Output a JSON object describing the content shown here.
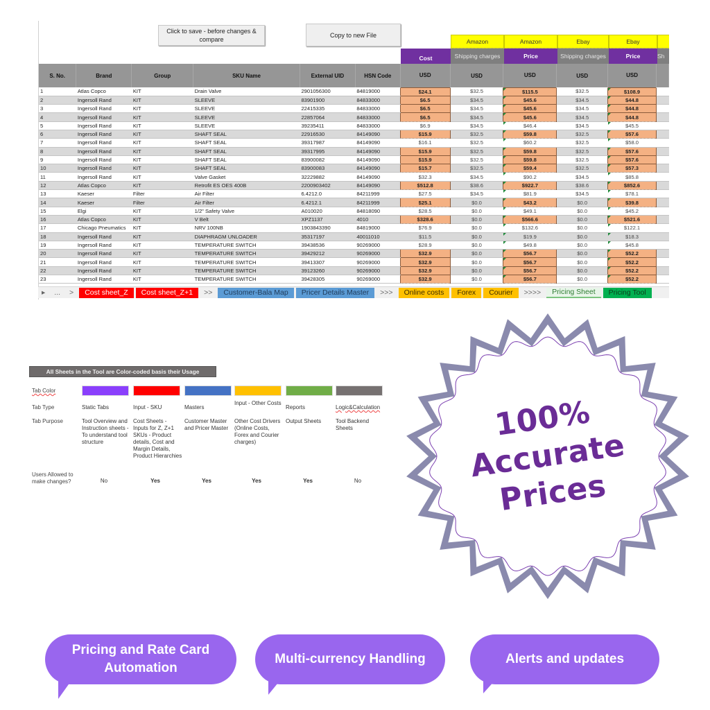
{
  "toolbar": {
    "save_label": "Click to save - before changes & compare",
    "copy_label": "Copy to new File"
  },
  "market_headers": [
    "Amazon",
    "Amazon",
    "Ebay",
    "Ebay"
  ],
  "sub_headers": [
    "Cost",
    "Shipping charges",
    "Price",
    "Shipping charges",
    "Price",
    "Sh"
  ],
  "columns": [
    "S. No.",
    "Brand",
    "Group",
    "SKU Name",
    "External UID",
    "HSN Code",
    "USD",
    "USD",
    "USD",
    "USD",
    "USD"
  ],
  "rows": [
    {
      "sno": "1",
      "brand": "Atlas Copco",
      "group": "KIT",
      "sku": "Drain Valve",
      "uid": "2901056300",
      "hsn": "84819000",
      "cost": "$24.1",
      "amz_ship": "$32.5",
      "amz_price": "$115.5",
      "ebay_ship": "$32.5",
      "ebay_price": "$108.9",
      "highlight": true
    },
    {
      "sno": "2",
      "brand": "Ingersoll Rand",
      "group": "KIT",
      "sku": "SLEEVE",
      "uid": "83901900",
      "hsn": "84833000",
      "cost": "$6.5",
      "amz_ship": "$34.5",
      "amz_price": "$45.6",
      "ebay_ship": "$34.5",
      "ebay_price": "$44.8",
      "highlight": true
    },
    {
      "sno": "3",
      "brand": "Ingersoll Rand",
      "group": "KIT",
      "sku": "SLEEVE",
      "uid": "22415335",
      "hsn": "84833000",
      "cost": "$6.5",
      "amz_ship": "$34.5",
      "amz_price": "$45.6",
      "ebay_ship": "$34.5",
      "ebay_price": "$44.8",
      "highlight": true
    },
    {
      "sno": "4",
      "brand": "Ingersoll Rand",
      "group": "KIT",
      "sku": "SLEEVE",
      "uid": "22857064",
      "hsn": "84833000",
      "cost": "$6.5",
      "amz_ship": "$34.5",
      "amz_price": "$45.6",
      "ebay_ship": "$34.5",
      "ebay_price": "$44.8",
      "highlight": true
    },
    {
      "sno": "5",
      "brand": "Ingersoll Rand",
      "group": "KIT",
      "sku": "SLEEVE",
      "uid": "39235411",
      "hsn": "84833000",
      "cost": "$6.9",
      "amz_ship": "$34.5",
      "amz_price": "$46.4",
      "ebay_ship": "$34.5",
      "ebay_price": "$45.5",
      "highlight": false
    },
    {
      "sno": "6",
      "brand": "Ingersoll Rand",
      "group": "KIT",
      "sku": "SHAFT SEAL",
      "uid": "22916530",
      "hsn": "84149090",
      "cost": "$15.9",
      "amz_ship": "$32.5",
      "amz_price": "$59.8",
      "ebay_ship": "$32.5",
      "ebay_price": "$57.6",
      "highlight": true
    },
    {
      "sno": "7",
      "brand": "Ingersoll Rand",
      "group": "KIT",
      "sku": "SHAFT SEAL",
      "uid": "39317987",
      "hsn": "84149090",
      "cost": "$16.1",
      "amz_ship": "$32.5",
      "amz_price": "$60.2",
      "ebay_ship": "$32.5",
      "ebay_price": "$58.0",
      "highlight": false
    },
    {
      "sno": "8",
      "brand": "Ingersoll Rand",
      "group": "KIT",
      "sku": "SHAFT SEAL",
      "uid": "39317995",
      "hsn": "84149090",
      "cost": "$15.9",
      "amz_ship": "$32.5",
      "amz_price": "$59.8",
      "ebay_ship": "$32.5",
      "ebay_price": "$57.6",
      "highlight": true
    },
    {
      "sno": "9",
      "brand": "Ingersoll Rand",
      "group": "KIT",
      "sku": "SHAFT SEAL",
      "uid": "83900082",
      "hsn": "84149090",
      "cost": "$15.9",
      "amz_ship": "$32.5",
      "amz_price": "$59.8",
      "ebay_ship": "$32.5",
      "ebay_price": "$57.6",
      "highlight": true
    },
    {
      "sno": "10",
      "brand": "Ingersoll Rand",
      "group": "KIT",
      "sku": "SHAFT SEAL",
      "uid": "83900083",
      "hsn": "84149090",
      "cost": "$15.7",
      "amz_ship": "$32.5",
      "amz_price": "$59.4",
      "ebay_ship": "$32.5",
      "ebay_price": "$57.3",
      "highlight": true
    },
    {
      "sno": "11",
      "brand": "Ingersoll Rand",
      "group": "KIT",
      "sku": "Valve Gasket",
      "uid": "32229882",
      "hsn": "84149090",
      "cost": "$32.3",
      "amz_ship": "$34.5",
      "amz_price": "$90.2",
      "ebay_ship": "$34.5",
      "ebay_price": "$85.8",
      "highlight": false
    },
    {
      "sno": "12",
      "brand": "Atlas Copco",
      "group": "KIT",
      "sku": "Retrofit ES OES 400B",
      "uid": "2200903402",
      "hsn": "84149090",
      "cost": "$512.8",
      "amz_ship": "$38.6",
      "amz_price": "$922.7",
      "ebay_ship": "$38.6",
      "ebay_price": "$852.6",
      "highlight": true
    },
    {
      "sno": "13",
      "brand": "Kaeser",
      "group": "Filter",
      "sku": "Air Filter",
      "uid": "6.4212.0",
      "hsn": "84211999",
      "cost": "$27.5",
      "amz_ship": "$34.5",
      "amz_price": "$81.9",
      "ebay_ship": "$34.5",
      "ebay_price": "$78.1",
      "highlight": false
    },
    {
      "sno": "14",
      "brand": "Kaeser",
      "group": "Filter",
      "sku": "Air Filter",
      "uid": "6.4212.1",
      "hsn": "84211999",
      "cost": "$25.1",
      "amz_ship": "$0.0",
      "amz_price": "$43.2",
      "ebay_ship": "$0.0",
      "ebay_price": "$39.8",
      "highlight": true
    },
    {
      "sno": "15",
      "brand": "Elgi",
      "group": "KIT",
      "sku": "1/2\" Safety Valve",
      "uid": "A010020",
      "hsn": "84818090",
      "cost": "$28.5",
      "amz_ship": "$0.0",
      "amz_price": "$49.1",
      "ebay_ship": "$0.0",
      "ebay_price": "$45.2",
      "highlight": false
    },
    {
      "sno": "16",
      "brand": "Atlas Copco",
      "group": "KIT",
      "sku": "V Belt",
      "uid": "XPZ1137",
      "hsn": "4010",
      "cost": "$328.6",
      "amz_ship": "$0.0",
      "amz_price": "$566.6",
      "ebay_ship": "$0.0",
      "ebay_price": "$521.6",
      "highlight": true
    },
    {
      "sno": "17",
      "brand": "Chicago Pneumatics",
      "group": "KIT",
      "sku": "NRV 100NB",
      "uid": "1903843390",
      "hsn": "84819000",
      "cost": "$76.9",
      "amz_ship": "$0.0",
      "amz_price": "$132.6",
      "ebay_ship": "$0.0",
      "ebay_price": "$122.1",
      "highlight": false
    },
    {
      "sno": "18",
      "brand": "Ingersoll Rand",
      "group": "KIT",
      "sku": "DIAPHRAGM UNLOADER",
      "uid": "35317197",
      "hsn": "40011010",
      "cost": "$11.5",
      "amz_ship": "$0.0",
      "amz_price": "$19.9",
      "ebay_ship": "$0.0",
      "ebay_price": "$18.3",
      "highlight": false
    },
    {
      "sno": "19",
      "brand": "Ingersoll Rand",
      "group": "KIT",
      "sku": "TEMPERATURE SWITCH",
      "uid": "39438536",
      "hsn": "90269000",
      "cost": "$28.9",
      "amz_ship": "$0.0",
      "amz_price": "$49.8",
      "ebay_ship": "$0.0",
      "ebay_price": "$45.8",
      "highlight": false
    },
    {
      "sno": "20",
      "brand": "Ingersoll Rand",
      "group": "KIT",
      "sku": "TEMPERATURE SWITCH",
      "uid": "39429212",
      "hsn": "90269000",
      "cost": "$32.9",
      "amz_ship": "$0.0",
      "amz_price": "$56.7",
      "ebay_ship": "$0.0",
      "ebay_price": "$52.2",
      "highlight": true
    },
    {
      "sno": "21",
      "brand": "Ingersoll Rand",
      "group": "KIT",
      "sku": "TEMPERATURE SWITCH",
      "uid": "39413307",
      "hsn": "90269000",
      "cost": "$32.9",
      "amz_ship": "$0.0",
      "amz_price": "$56.7",
      "ebay_ship": "$0.0",
      "ebay_price": "$52.2",
      "highlight": true
    },
    {
      "sno": "22",
      "brand": "Ingersoll Rand",
      "group": "KIT",
      "sku": "TEMPERATURE SWITCH",
      "uid": "39123260",
      "hsn": "90269000",
      "cost": "$32.9",
      "amz_ship": "$0.0",
      "amz_price": "$56.7",
      "ebay_ship": "$0.0",
      "ebay_price": "$52.2",
      "highlight": true
    },
    {
      "sno": "23",
      "brand": "Ingersoll Rand",
      "group": "KIT",
      "sku": "TEMPERATURE SWITCH",
      "uid": "39428305",
      "hsn": "90269000",
      "cost": "$32.9",
      "amz_ship": "$0.0",
      "amz_price": "$56.7",
      "ebay_ship": "$0.0",
      "ebay_price": "$52.2",
      "highlight": true
    }
  ],
  "sheet_tabs": [
    {
      "label": "...",
      "kind": "nav"
    },
    {
      "label": ">",
      "kind": "nav"
    },
    {
      "label": "Cost sheet_Z",
      "kind": "red"
    },
    {
      "label": "Cost sheet_Z+1",
      "kind": "red"
    },
    {
      "label": ">>",
      "kind": "nav"
    },
    {
      "label": "Customer-Bala Map",
      "kind": "blue"
    },
    {
      "label": "Pricer Details Master",
      "kind": "blue"
    },
    {
      "label": ">>>",
      "kind": "nav"
    },
    {
      "label": "Online costs",
      "kind": "amber"
    },
    {
      "label": "Forex",
      "kind": "amber"
    },
    {
      "label": "Courier",
      "kind": "amber"
    },
    {
      "label": ">>>>",
      "kind": "nav"
    },
    {
      "label": "Pricing Sheet",
      "kind": "active-green"
    },
    {
      "label": "Pricing Tool",
      "kind": "green"
    }
  ],
  "legend": {
    "title": "All Sheets in the Tool are Color-coded basis their Usage",
    "row_labels": {
      "color": "Tab Color",
      "type": "Tab Type",
      "purpose": "Tab Purpose",
      "users": "Users Allowed to make changes?"
    },
    "categories": [
      {
        "color": "#8a3ffc",
        "type": "Static Tabs",
        "purpose": "Tool Overview and Instruction sheets - To understand tool structure",
        "users": "No"
      },
      {
        "color": "#ff0000",
        "type": "Input - SKU",
        "purpose": "Cost Sheets - Inputs for Z, Z+1 SKUs - Product details, Cost and Margin Details, Product Hierarchies",
        "users": "Yes"
      },
      {
        "color": "#4472c4",
        "type": "Masters",
        "purpose": "Customer Master and Pricer Master",
        "users": "Yes"
      },
      {
        "color": "#ffc000",
        "type": "Input - Other Costs",
        "purpose": "Other Cost Drivers (Online Costs, Forex and Courier charges)",
        "users": "Yes"
      },
      {
        "color": "#70ad47",
        "type": "Reports",
        "purpose": "Output Sheets",
        "users": "Yes"
      },
      {
        "color": "#767171",
        "type": "Logic&Calculation",
        "purpose": "Tool Backend Sheets",
        "users": "No"
      }
    ]
  },
  "badge": {
    "line1": "100%",
    "line2": "Accurate",
    "line3": "Prices"
  },
  "bubbles": [
    "Pricing and Rate Card Automation",
    "Multi-currency Handling",
    "Alerts and updates"
  ],
  "colors": {
    "purple_header": "#7030a0",
    "market_yellow": "#ffff00",
    "highlight_orange": "#f4b183",
    "badge_frame": "#8a8aad",
    "badge_text": "#6a2c96",
    "bubble": "#9966ee"
  }
}
